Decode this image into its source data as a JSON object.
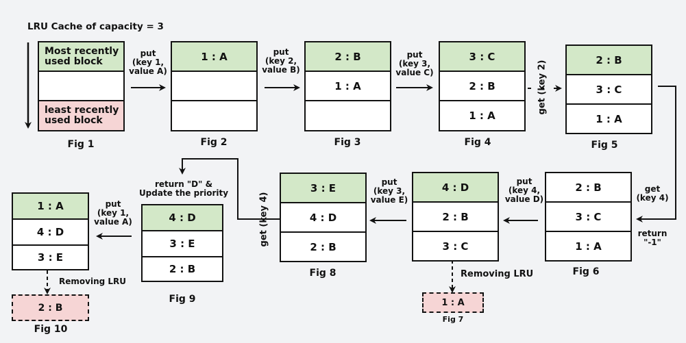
{
  "title": "LRU Cache of capacity = 3",
  "fig1": {
    "caption": "Fig 1",
    "mru_label": "Most recently used block",
    "lru_label": "least recently used block"
  },
  "figures": [
    {
      "id": "fig2",
      "caption": "Fig 2",
      "cells": [
        "1 : A",
        "",
        ""
      ]
    },
    {
      "id": "fig3",
      "caption": "Fig 3",
      "cells": [
        "2 : B",
        "1 : A",
        ""
      ]
    },
    {
      "id": "fig4",
      "caption": "Fig 4",
      "cells": [
        "3 : C",
        "2 : B",
        "1 : A"
      ]
    },
    {
      "id": "fig5",
      "caption": "Fig 5",
      "cells": [
        "2 : B",
        "3 : C",
        "1 : A"
      ]
    },
    {
      "id": "fig6",
      "caption": "Fig 6",
      "cells": [
        "2 : B",
        "3 : C",
        "1 : A"
      ]
    },
    {
      "id": "fig7",
      "caption": "Fig 7",
      "cells": [
        "4 : D",
        "2 : B",
        "3 : C"
      ],
      "removed": "1 : A"
    },
    {
      "id": "fig8",
      "caption": "Fig 8",
      "cells": [
        "3 : E",
        "4 : D",
        "2 : B"
      ]
    },
    {
      "id": "fig9",
      "caption": "Fig 9",
      "cells": [
        "4 : D",
        "3 : E",
        "2 : B"
      ]
    },
    {
      "id": "fig10",
      "caption": "Fig 10",
      "cells": [
        "1 : A",
        "4 : D",
        "3 : E"
      ],
      "removed": "2 : B"
    }
  ],
  "operations": {
    "op1": [
      "put",
      "(key 1,",
      "value A)"
    ],
    "op2": [
      "put",
      "(key 2,",
      "value B)"
    ],
    "op3": [
      "put",
      "(key 3,",
      "value C)"
    ],
    "op4": "get (key 2)",
    "op5": [
      "get",
      "(key 4)"
    ],
    "op5_return": [
      "return",
      "\"-1\""
    ],
    "op6": [
      "put",
      "(key 4,",
      "value D)"
    ],
    "op7": [
      "put",
      "(key 3,",
      "value E)"
    ],
    "op8": "get (key 4)",
    "op8_return": [
      "return \"D\" &",
      "Update the priority"
    ],
    "op9": [
      "put",
      "(key 1,",
      "value A)"
    ],
    "removing_lru": "Removing LRU"
  }
}
